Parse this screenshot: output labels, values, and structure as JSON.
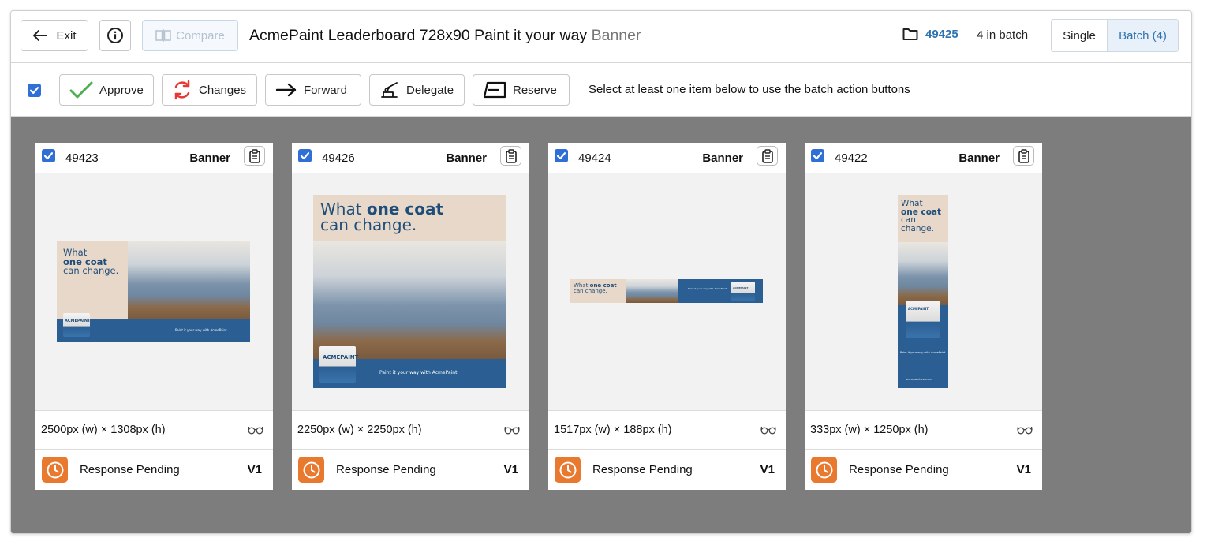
{
  "header": {
    "exit_label": "Exit",
    "compare_label": "Compare",
    "title_main": "AcmePaint Leaderboard 728x90 Paint it your way",
    "title_type": "Banner",
    "batch_id": "49425",
    "batch_count": "4 in batch",
    "view_single": "Single",
    "view_batch": "Batch (4)"
  },
  "toolbar": {
    "approve": "Approve",
    "changes": "Changes",
    "forward": "Forward",
    "delegate": "Delegate",
    "reserve": "Reserve",
    "hint": "Select at least one item below to use the batch action buttons"
  },
  "colors": {
    "accent": "#2f73b0",
    "checkbox": "#2f6fd6",
    "pending": "#e9792f",
    "canvas": "#7d7d7d"
  },
  "cards": [
    {
      "id": "49423",
      "type": "Banner",
      "dims": "2500px (w) × 1308px (h)",
      "status": "Response Pending",
      "version": "V1",
      "art": {
        "line1": "What",
        "line2": "one coat",
        "line3": "can change.",
        "brand": "ACMEPAINT",
        "tagline": "Paint it your way with AcmePaint"
      }
    },
    {
      "id": "49426",
      "type": "Banner",
      "dims": "2250px (w) × 2250px (h)",
      "status": "Response Pending",
      "version": "V1",
      "art": {
        "line1": "What",
        "line2": "one coat",
        "line3": "can change.",
        "brand": "ACMEPAINT",
        "tagline": "Paint it your way with AcmePaint"
      }
    },
    {
      "id": "49424",
      "type": "Banner",
      "dims": "1517px (w) × 188px (h)",
      "status": "Response Pending",
      "version": "V1",
      "art": {
        "line1": "What",
        "line2": "one coat",
        "line3": "can change.",
        "brand": "ACMEPAINT",
        "tagline": "Paint it your way with AcmePaint"
      }
    },
    {
      "id": "49422",
      "type": "Banner",
      "dims": "333px (w) × 1250px (h)",
      "status": "Response Pending",
      "version": "V1",
      "art": {
        "line1": "What",
        "line2": "one coat",
        "line3": "can",
        "line4": "change.",
        "brand": "ACMEPAINT",
        "tagline": "Paint it your way with AcmePaint",
        "url": "acmepaint.com.au"
      }
    }
  ]
}
